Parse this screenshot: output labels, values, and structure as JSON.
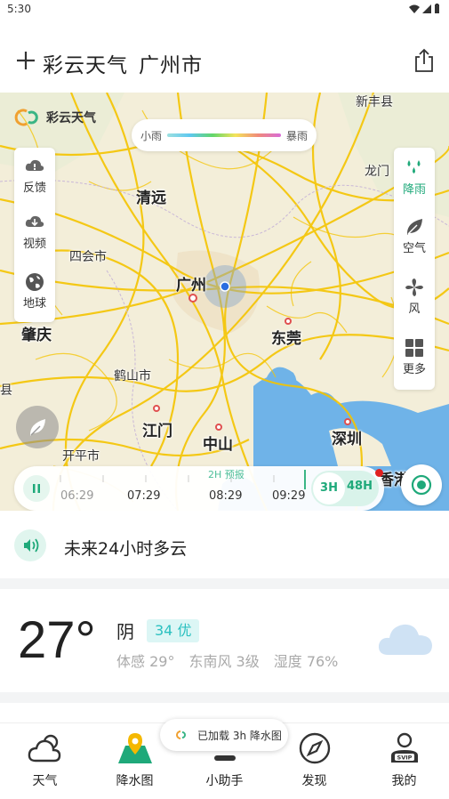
{
  "status_bar": {
    "time": "5:30"
  },
  "header": {
    "app_name": "彩云天气",
    "city": "广州市"
  },
  "map": {
    "logo_text": "彩云天气",
    "legend": {
      "low": "小雨",
      "high": "暴雨"
    },
    "left_panel": [
      {
        "label": "反馈",
        "icon": "feedback-icon"
      },
      {
        "label": "视频",
        "icon": "video-icon"
      },
      {
        "label": "地球",
        "icon": "globe-icon"
      }
    ],
    "right_panel": [
      {
        "label": "降雨",
        "icon": "rain-icon"
      },
      {
        "label": "空气",
        "icon": "leaf-icon"
      },
      {
        "label": "风",
        "icon": "wind-icon"
      },
      {
        "label": "更多",
        "icon": "grid-icon"
      }
    ],
    "places": {
      "xinfeng": "新丰县",
      "longmen": "龙门",
      "qingyuan": "清远",
      "sihui": "四会市",
      "guangzhou": "广州",
      "zhaoqing": "肇庆",
      "dongguan": "东莞",
      "heshan": "鹤山市",
      "jiangmen": "江门",
      "zhongshan": "中山",
      "shenzhen": "深圳",
      "kaiping": "开平市",
      "hongkong": "香港",
      "xian": "县"
    },
    "timeline": {
      "forecast_label": "2H 预报",
      "times": [
        "06:29",
        "07:29",
        "08:29",
        "09:29"
      ],
      "toggle_3h": "3H",
      "toggle_48h": "48H"
    }
  },
  "alert": {
    "text": "未来24小时多云"
  },
  "current": {
    "temperature": "27°",
    "condition": "阴",
    "aqi": "34 优",
    "feels_like": "体感 29°",
    "wind": "东南风 3级",
    "humidity": "湿度 76%"
  },
  "toast": {
    "text": "已加载 3h 降水图"
  },
  "nav": [
    {
      "label": "天气",
      "icon": "weather-icon"
    },
    {
      "label": "降水图",
      "icon": "map-pin-icon"
    },
    {
      "label": "小助手",
      "icon": "assistant-icon"
    },
    {
      "label": "发现",
      "icon": "compass-icon"
    },
    {
      "label": "我的",
      "icon": "profile-icon"
    }
  ],
  "colors": {
    "accent": "#1fa97a",
    "aqi_text": "#2bc0c0",
    "road": "#f5c400",
    "water": "#6fb3e8"
  }
}
